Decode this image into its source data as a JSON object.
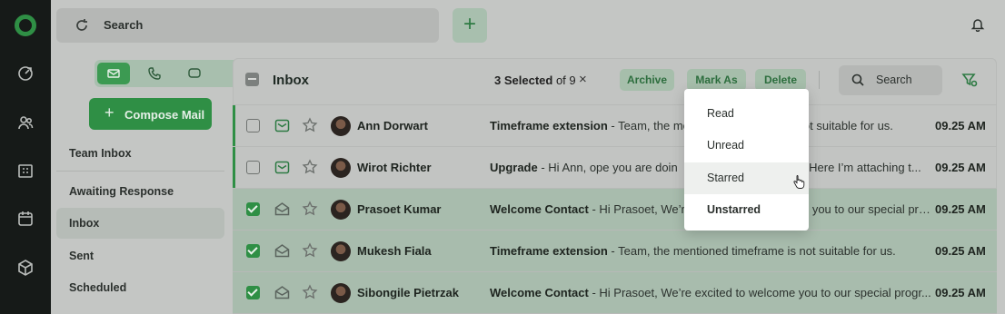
{
  "topbar": {
    "search_placeholder": "Search",
    "plus_label": "+"
  },
  "rail": {
    "icons": [
      "dashboard-icon",
      "contacts-icon",
      "building-icon",
      "calendar-icon",
      "package-icon"
    ]
  },
  "sidebar": {
    "compose_label": "Compose Mail",
    "items": [
      {
        "label": "Team Inbox"
      },
      {
        "label": "Awaiting Response"
      },
      {
        "label": "Inbox"
      },
      {
        "label": "Sent"
      },
      {
        "label": "Scheduled"
      }
    ],
    "active_item": "Inbox"
  },
  "toolbar": {
    "title": "Inbox",
    "selected_count": "3 Selected",
    "of_total": "of 9",
    "close": "×",
    "archive": "Archive",
    "mark_as": "Mark As",
    "delete": "Delete",
    "search": "Search"
  },
  "emails": [
    {
      "name": "Ann Dorwart",
      "subject": "Timeframe extension",
      "preview": "Team, the me",
      "preview_after": "ot suitable for us.",
      "time": "09.25 AM",
      "selected": false,
      "unread": true
    },
    {
      "name": "Wirot Richter",
      "subject": "Upgrade",
      "preview": "Hi Ann, ope you are doin",
      "preview_after": "d, Here I’m attaching t...",
      "time": "09.25 AM",
      "selected": false,
      "unread": true
    },
    {
      "name": "Prasoet Kumar",
      "subject": "Welcome Contact",
      "preview": "Hi Prasoet, We’r",
      "preview_after": "you to our special progr...",
      "time": "09.25 AM",
      "selected": true,
      "unread": false
    },
    {
      "name": "Mukesh Fiala",
      "subject": "Timeframe extension",
      "preview": "Team, the mentioned timeframe is not suitable for us.",
      "preview_after": "",
      "time": "09.25 AM",
      "selected": true,
      "unread": false
    },
    {
      "name": "Sibongile Pietrzak",
      "subject": "Welcome Contact",
      "preview": "Hi Prasoet, We’re excited to welcome you to our special progr...",
      "preview_after": "",
      "time": "09.25 AM",
      "selected": true,
      "unread": false
    }
  ],
  "mark_as_menu": {
    "options": [
      "Read",
      "Unread",
      "Starred",
      "Unstarred"
    ],
    "hovered": "Starred"
  },
  "colors": {
    "accent": "#2f8f45",
    "selected_row": "#a8bcad",
    "rail": "#161a18"
  }
}
